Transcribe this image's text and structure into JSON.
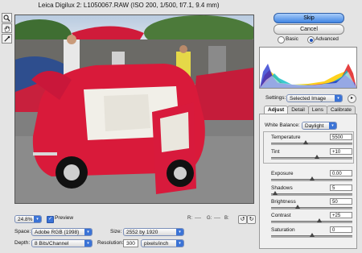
{
  "window": {
    "title": "Leica Digilux 2:  L1050067.RAW  (ISO 200, 1/500, f/7.1, 9.4 mm)"
  },
  "tools": [
    "zoom-icon",
    "hand-icon",
    "eyedropper-icon"
  ],
  "preview": {
    "zoom_value": "24.8%",
    "preview_label": "Preview",
    "preview_checked": true,
    "rgb": {
      "r_label": "R:",
      "g_label": "G:",
      "b_label": "B:",
      "r": "----",
      "g": "----",
      "b": "----"
    }
  },
  "buttons": {
    "skip": "Skip",
    "cancel": "Cancel"
  },
  "mode": {
    "basic": "Basic",
    "advanced": "Advanced",
    "selected": "advanced"
  },
  "settings": {
    "label": "Settings:",
    "value": "Selected Image"
  },
  "tabs": [
    {
      "label": "Adjust",
      "active": true
    },
    {
      "label": "Detail",
      "active": false
    },
    {
      "label": "Lens",
      "active": false
    },
    {
      "label": "Calibrate",
      "active": false
    }
  ],
  "adjust": {
    "white_balance_label": "White Balance:",
    "white_balance_value": "Daylight",
    "sliders": [
      {
        "name": "Temperature",
        "value": "5500",
        "pos": 0.43
      },
      {
        "name": "Tint",
        "value": "+10",
        "pos": 0.56
      },
      {
        "name": "Exposure",
        "value": "0.00",
        "pos": 0.5
      },
      {
        "name": "Shadows",
        "value": "5",
        "pos": 0.05
      },
      {
        "name": "Brightness",
        "value": "50",
        "pos": 0.33
      },
      {
        "name": "Contrast",
        "value": "+25",
        "pos": 0.59
      },
      {
        "name": "Saturation",
        "value": "0",
        "pos": 0.5
      }
    ]
  },
  "bottom": {
    "space_label": "Space:",
    "space_value": "Adobe RGB (1998)",
    "depth_label": "Depth:",
    "depth_value": "8 Bits/Channel",
    "size_label": "Size:",
    "size_value": "2552 by 1920",
    "resolution_label": "Resolution:",
    "resolution_value": "300",
    "resolution_unit": "pixels/inch"
  },
  "colors": {
    "accent": "#3b73d6",
    "primary_button": "#5a97ec",
    "car_red": "#d91a3a"
  }
}
